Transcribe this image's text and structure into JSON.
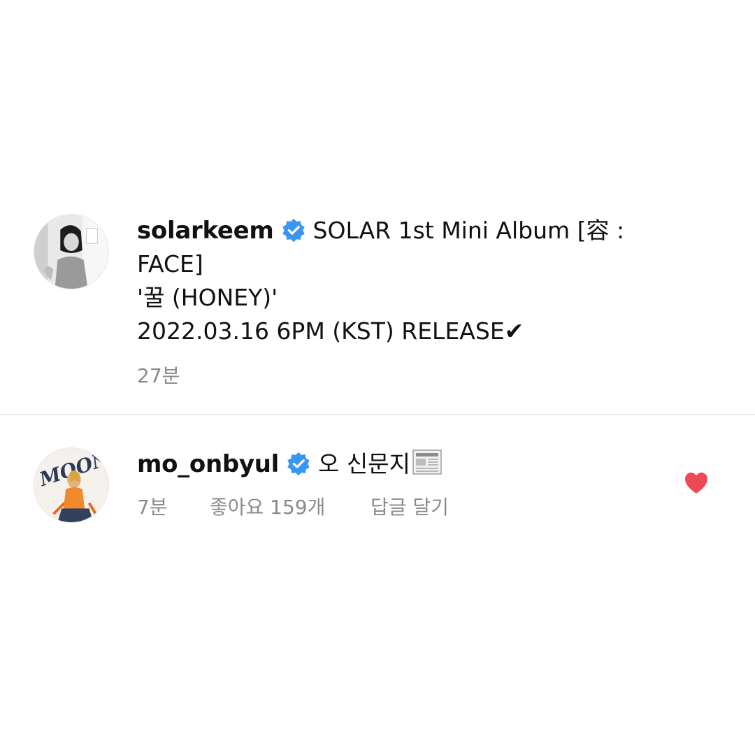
{
  "post": {
    "username": "solarkeem",
    "caption_lines": [
      "SOLAR 1st Mini Album [容 :",
      "FACE]",
      "'꿀 (HONEY)'",
      "2022.03.16 6PM (KST) RELEASE✔"
    ],
    "time": "27분",
    "avatar_icon": "profile-photo-grayscale",
    "verified_icon": "verified-badge-icon"
  },
  "comment": {
    "username": "mo_onbyul",
    "text": "오 신문지",
    "emoji_icon": "newspaper-icon",
    "time": "7분",
    "likes": "좋아요 159개",
    "reply": "답글 달기",
    "liked": true,
    "heart_icon": "heart-icon",
    "avatar_icon": "profile-photo-moon"
  },
  "colors": {
    "verified_blue": "#3897f0",
    "heart_red": "#ed4956",
    "meta_gray": "#8a8a8a",
    "divider": "#e8e8e8"
  }
}
